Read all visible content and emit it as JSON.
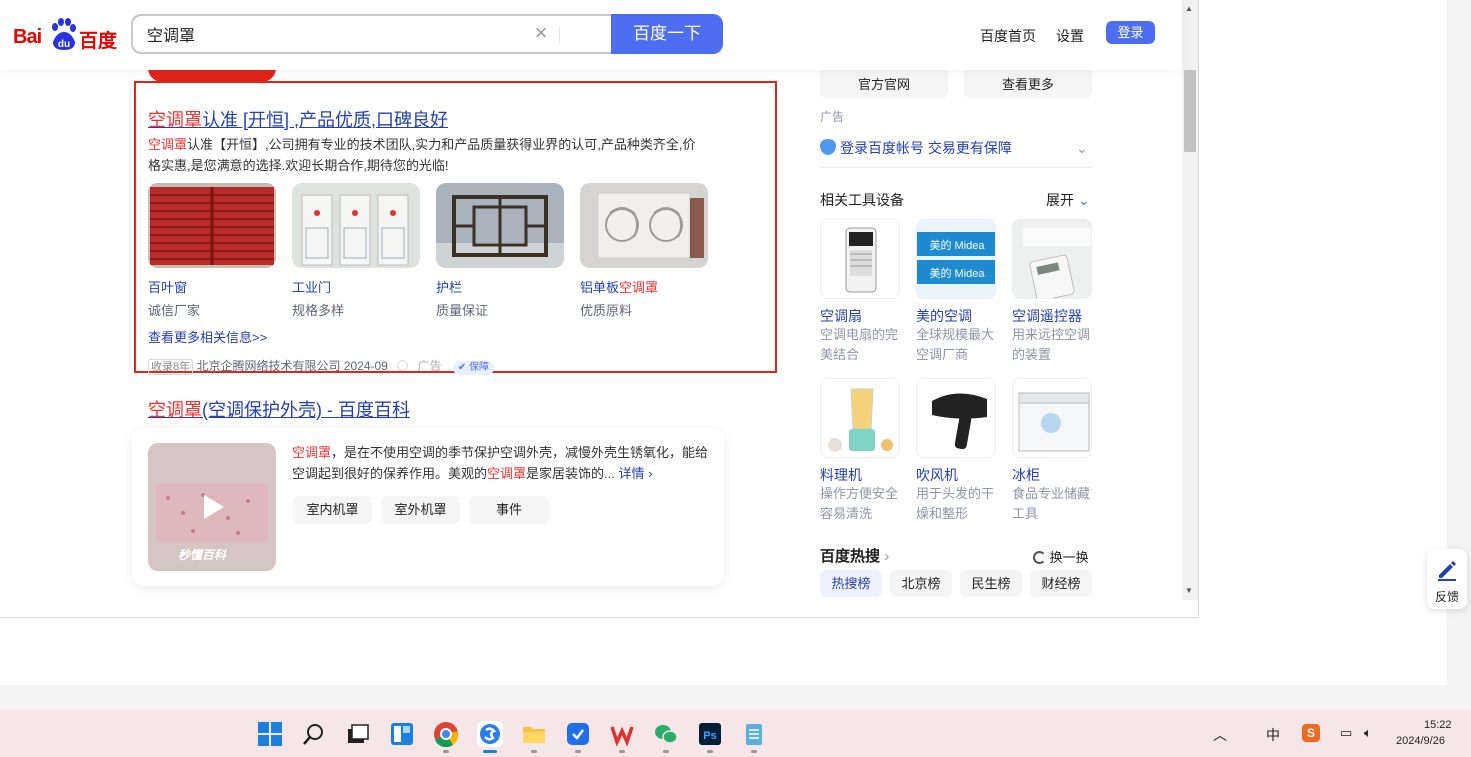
{
  "header": {
    "logo_left": "Bai",
    "logo_mid": "du",
    "logo_right": "百度",
    "search_value": "空调罩",
    "search_button": "百度一下",
    "links": [
      "百度首页",
      "设置"
    ],
    "login": "登录"
  },
  "ad": {
    "title_em": "空调罩",
    "title_rest": "认准 [开恒] ,产品优质,口碑良好",
    "desc_em": "空调罩",
    "desc_rest": "认准【开恒】,公司拥有专业的技术团队,实力和产品质量获得业界的认可,产品种类齐全,价格实惠,是您满意的选择.欢迎长期合作,期待您的光临!",
    "products": [
      {
        "name": "百叶窗",
        "sub": "诚信厂家"
      },
      {
        "name": "工业门",
        "sub": "规格多样"
      },
      {
        "name": "护栏",
        "sub": "质量保证"
      },
      {
        "name_pre": "铝单板",
        "name_em": "空调罩",
        "sub": "优质原料"
      }
    ],
    "more": "查看更多相关信息>>",
    "footer_badge": "收录8年",
    "footer_company": "北京企腾网络技术有限公司 2024-09",
    "footer_ad": "广告",
    "footer_guarantee": "保障"
  },
  "baike": {
    "title_em": "空调罩",
    "title_rest": "(空调保护外壳) - 百度百科",
    "text_em1": "空调罩",
    "text_part1": "，是在不使用空调的季节保护空调外壳，减慢外壳生锈氧化，能给空调起到很好的保养作用。美观的",
    "text_em2": "空调罩",
    "text_part2": "是家居装饰的...",
    "detail": "详情",
    "chips": [
      "室内机罩",
      "室外机罩",
      "事件"
    ],
    "watermark": "秒懂百科"
  },
  "right": {
    "btn_official": "官方官网",
    "btn_more": "查看更多",
    "ad_label": "广告",
    "login_prompt": "登录百度帐号 交易更有保障",
    "tools_title": "相关工具设备",
    "expand": "展开",
    "tools": [
      {
        "name": "空调扇",
        "desc": "空调电扇的完美结合"
      },
      {
        "name": "美的空调",
        "desc": "全球规模最大空调厂商"
      },
      {
        "name": "空调遥控器",
        "desc": "用来远控空调的装置"
      },
      {
        "name": "料理机",
        "desc": "操作方便安全容易清洗"
      },
      {
        "name": "吹风机",
        "desc": "用于头发的干燥和整形"
      },
      {
        "name": "冰柜",
        "desc": "食品专业储藏工具"
      }
    ],
    "hot_title": "百度热搜",
    "refresh": "换一换",
    "hot_tabs": [
      "热搜榜",
      "北京榜",
      "民生榜",
      "财经榜"
    ]
  },
  "feedback": "反馈",
  "taskbar": {
    "time": "15:22",
    "date": "2024/9/26",
    "ime": "中"
  }
}
